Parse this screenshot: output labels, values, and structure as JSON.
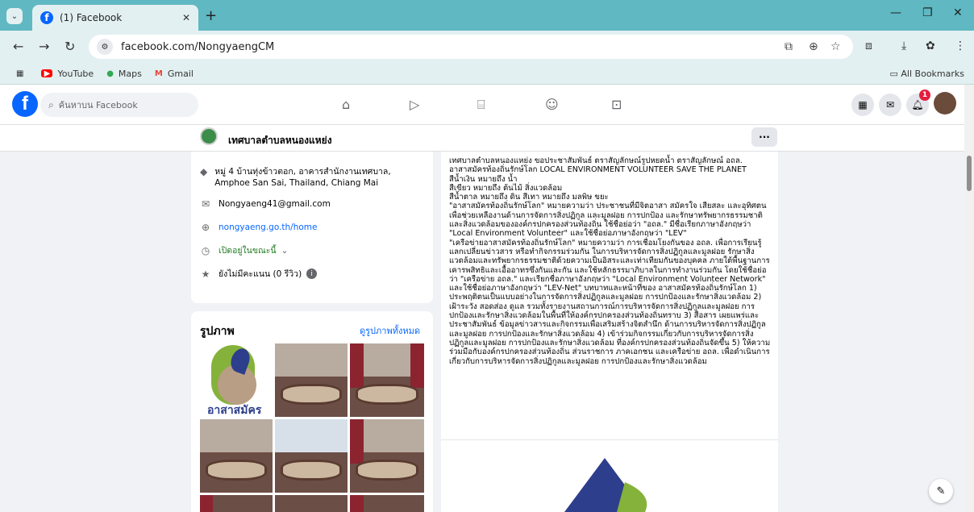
{
  "browser": {
    "tab_title": "(1) Facebook",
    "new_tab": "+",
    "url": "facebook.com/NongyaengCM",
    "bookmarks": [
      {
        "label": "YouTube"
      },
      {
        "label": "Maps"
      },
      {
        "label": "Gmail"
      }
    ],
    "all_bookmarks": "All Bookmarks"
  },
  "fb": {
    "search_placeholder": "ค้นหาบน Facebook",
    "notification_count": "1"
  },
  "page": {
    "name": "เทศบาลตำบลหนองแหย่ง",
    "more": "···"
  },
  "intro": {
    "address": "หมู่ 4 บ้านทุ่งข้าวตอก, อาคารสำนักงานเทศบาล, Amphoe San Sai, Thailand, Chiang Mai",
    "email": "Nongyaeng41@gmail.com",
    "website": "nongyaeng.go.th/home",
    "hours": "เปิดอยู่ในขณะนี้",
    "rating": "ยังไม่มีคะแนน (0 รีวิว)"
  },
  "photos": {
    "title": "รูปภาพ",
    "see_all": "ดูรูปภาพทั้งหมด",
    "logo_text": "อาสาสมัคร"
  },
  "post": {
    "text": "เทศบาลตำบลหนองแหย่ง ขอประชาสัมพันธ์ ตราสัญลักษณ์รูปหยดน้ำ ตราสัญลักษณ์ อถล.\nอาสาสมัครท้องถิ่นรักษ์โลก LOCAL ENVIRONMENT VOLUNTEER SAVE THE PLANET\nสีน้ำเงิน หมายถึง น้ำ\nสีเขียว หมายถึง ต้นไม้ สิ่งแวดล้อม\nสีน้ำตาล หมายถึง ดิน สีเทา หมายถึง มลพิษ ขยะ\n\"อาสาสมัครท้องถิ่นรักษ์โลก\" หมายความว่า ประชาชนที่มีจิตอาสา สมัครใจ เสียสละ และอุทิศตน เพื่อช่วยเหลืองานด้านการจัดการสิ่งปฏิกูล และมูลฝอย การปกป้อง และรักษาทรัพยากรธรรมชาติ และสิ่งแวดล้อมขององค์กรปกครองส่วนท้องถิ่น ใช้ชื่อย่อว่า \"อถล.\" มีชื่อเรียกภาษาอังกฤษว่า \"Local Environment Volunteer\" และใช้ชื่อย่อภาษาอังกฤษว่า \"LEV\"\n\"เครือข่ายอาสาสมัครท้องถิ่นรักษ์โลก\" หมายความว่า การเชื่อมโยงกันของ อถล. เพื่อการเรียนรู้ แลกเปลี่ยนข่าวสาร หรือทำกิจกรรมร่วมกัน ในการบริหารจัดการสิ่งปฏิกูลและมูลฝอย รักษาสิ่งแวดล้อมและทรัพยากรธรรมชาติด้วยความเป็นอิสระและเท่าเทียมกันของบุคคล ภายใต้พื้นฐานการเคารพสิทธิและเอื้ออาทรซึ่งกันและกัน และใช้หลักธรรมาภิบาลในการทำงานร่วมกัน โดยใช้ชื่อย่อว่า \"เครือข่าย อถล.\" และเรียกชื่อภาษาอังกฤษว่า \"Local Environment Volunteer Network\" และใช้ชื่อย่อภาษาอังกฤษว่า \"LEV-Net\" บทบาทและหน้าที่ของ อาสาสมัครท้องถิ่นรักษ์โลก 1) ประพฤติตนเป็นแบบอย่างในการจัดการสิ่งปฏิกูลและมูลฝอย การปกป้องและรักษาสิ่งแวดล้อม 2) เฝ้าระวัง สอดส่อง ดูแล รวมทั้งรายงานสถานการณ์การบริหารจัดการสิ่งปฏิกูลและมูลฝอย การปกป้องและรักษาสิ่งแวดล้อมในพื้นที่ให้องค์กรปกครองส่วนท้องถิ่นทราบ 3) สื่อสาร เผยแพร่และประชาสัมพันธ์ ข้อมูลข่าวสารและกิจกรรมเพื่อเสริมสร้างจิตสำนึก ด้านการบริหารจัดการสิ่งปฏิกูลและมูลฝอย การปกป้องและรักษาสิ่งแวดล้อม 4) เข้าร่วมกิจกรรมเกี่ยวกับการบริหารจัดการสิ่งปฏิกูลและมูลฝอย การปกป้องและรักษาสิ่งแวดล้อม ที่องค์กรปกครองส่วนท้องถิ่นจัดขึ้น 5) ให้ความร่วมมือกับองค์กรปกครองส่วนท้องถิ่น ส่วนราชการ ภาคเอกชน และเครือข่าย อถล. เพื่อดำเนินการเกี่ยวกับการบริหารจัดการสิ่งปฏิกูลและมูลฝอย การปกป้องและรักษาสิ่งแวดล้อม"
  }
}
